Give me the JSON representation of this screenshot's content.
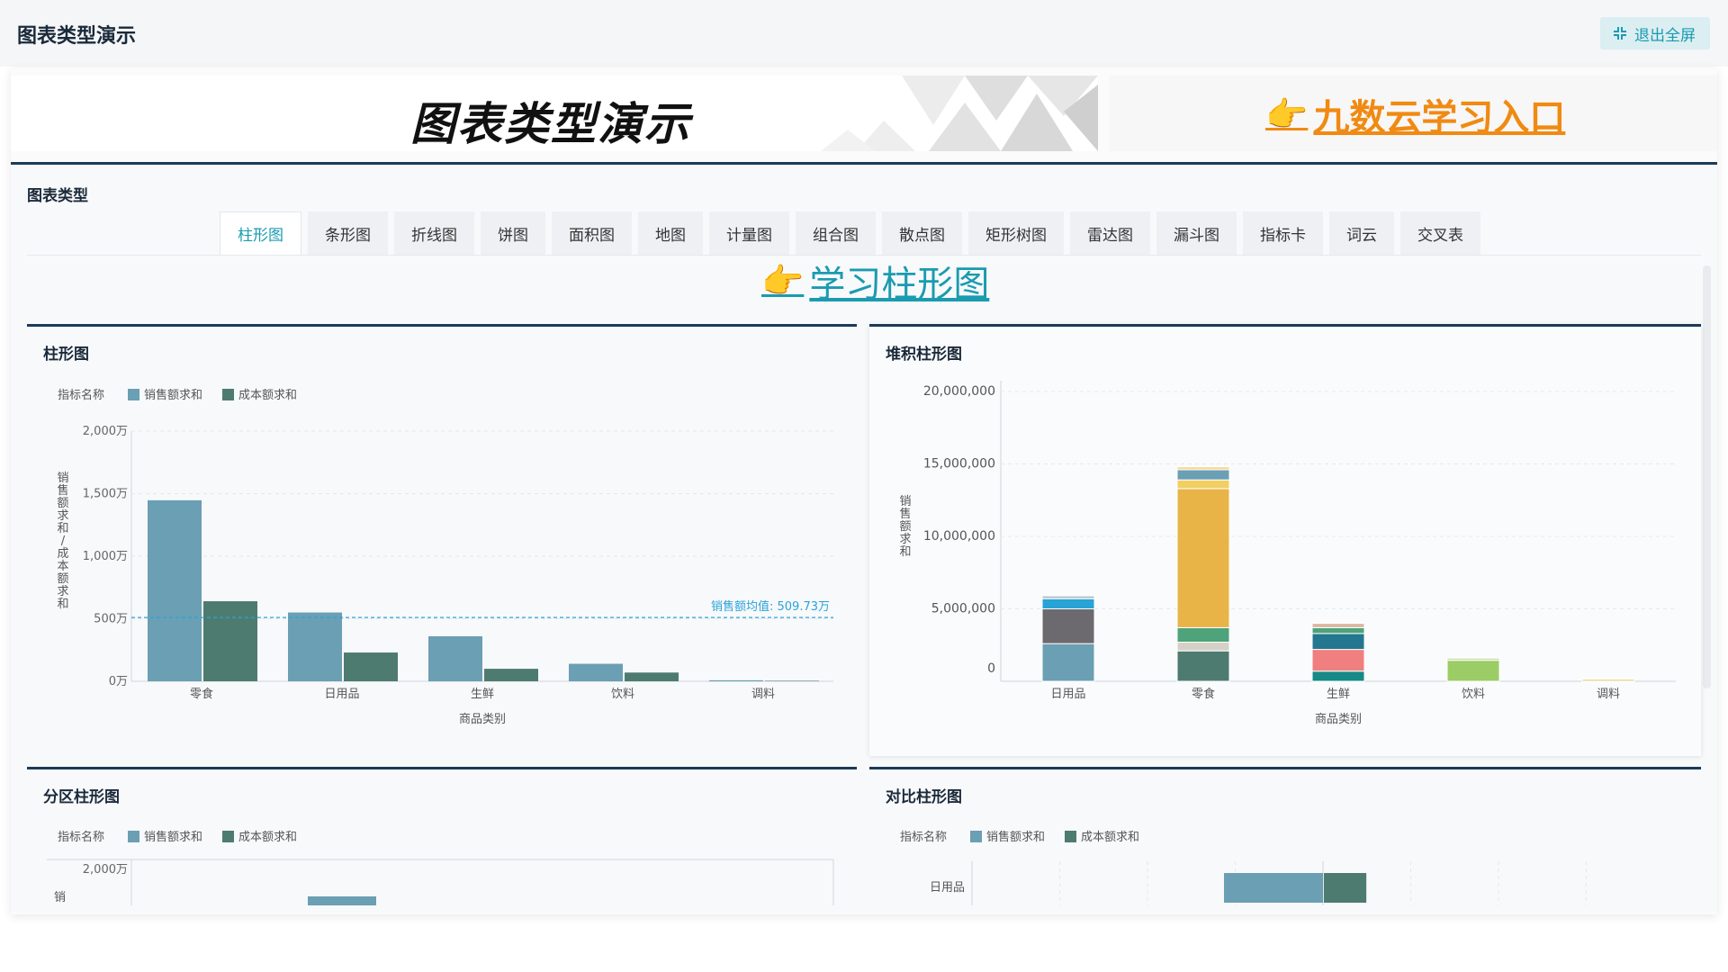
{
  "app": {
    "title": "图表类型演示",
    "exit_fullscreen": "退出全屏"
  },
  "banner": {
    "title": "图表类型演示",
    "entry_link": "九数云学习入口"
  },
  "panel": {
    "title": "图表类型",
    "tabs": [
      {
        "label": "柱形图",
        "active": true
      },
      {
        "label": "条形图"
      },
      {
        "label": "折线图"
      },
      {
        "label": "饼图"
      },
      {
        "label": "面积图"
      },
      {
        "label": "地图"
      },
      {
        "label": "计量图"
      },
      {
        "label": "组合图"
      },
      {
        "label": "散点图"
      },
      {
        "label": "矩形树图"
      },
      {
        "label": "雷达图"
      },
      {
        "label": "漏斗图"
      },
      {
        "label": "指标卡"
      },
      {
        "label": "词云"
      },
      {
        "label": "交叉表"
      }
    ],
    "learn_link": "学习柱形图"
  },
  "colors": {
    "sales": "#6b9fb4",
    "cost": "#4e7b70",
    "accent": "#1a9bb0",
    "brand_orange": "#f08a12",
    "header_navy": "#1d3a57",
    "avg_line": "#2aa3d9"
  },
  "chart_data": [
    {
      "type": "bar",
      "title": "柱形图",
      "legend_title": "指标名称",
      "legend_position": "top-left",
      "categories": [
        "零食",
        "日用品",
        "生鲜",
        "饮料",
        "调料"
      ],
      "series": [
        {
          "name": "销售额求和",
          "values": [
            1447,
            550,
            360,
            140,
            8
          ]
        },
        {
          "name": "成本额求和",
          "values": [
            640,
            230,
            100,
            70,
            4
          ]
        }
      ],
      "y_ticks": [
        "0万",
        "500万",
        "1,000万",
        "1,500万",
        "2,000万"
      ],
      "ylim": [
        0,
        2000
      ],
      "ylabel": "销售额求和/成本额求和",
      "xlabel": "商品类别",
      "reference_line": {
        "label": "销售额均值: 509.73万",
        "value": 509.73
      },
      "grid": true
    },
    {
      "type": "bar",
      "stacked": true,
      "title": "堆积柱形图",
      "categories": [
        "日用品",
        "零食",
        "生鲜",
        "饮料",
        "调料"
      ],
      "stacks": [
        [
          {
            "value": 2600000,
            "color": "#6b9fb4"
          },
          {
            "value": 2400000,
            "color": "#6c6a6e"
          },
          {
            "value": 700000,
            "color": "#27a3d6"
          },
          {
            "value": 200000,
            "color": "#b7c4cc"
          }
        ],
        [
          {
            "value": 2100000,
            "color": "#4e7b70"
          },
          {
            "value": 600000,
            "color": "#d6d0c8"
          },
          {
            "value": 1000000,
            "color": "#4fa37a"
          },
          {
            "value": 9600000,
            "color": "#e9b447"
          },
          {
            "value": 600000,
            "color": "#f1cf63"
          },
          {
            "value": 700000,
            "color": "#6b9fb4"
          },
          {
            "value": 200000,
            "color": "#f4d890"
          }
        ],
        [
          {
            "value": 700000,
            "color": "#168a87"
          },
          {
            "value": 1500000,
            "color": "#f07f7f"
          },
          {
            "value": 1100000,
            "color": "#23778f"
          },
          {
            "value": 400000,
            "color": "#4fa37a"
          },
          {
            "value": 300000,
            "color": "#d9b8a2"
          }
        ],
        [
          {
            "value": 1450000,
            "color": "#9ccc65"
          },
          {
            "value": 150000,
            "color": "#c7dca8"
          }
        ],
        [
          {
            "value": 150000,
            "color": "#e6d690"
          },
          {
            "value": 50000,
            "color": "#b9c26a"
          }
        ]
      ],
      "y_ticks": [
        "0",
        "5,000,000",
        "10,000,000",
        "15,000,000",
        "20,000,000"
      ],
      "ylim": [
        0,
        20000000
      ],
      "ylabel": "销售额求和",
      "xlabel": "商品类别",
      "grid": true
    },
    {
      "type": "bar",
      "title": "分区柱形图",
      "legend_title": "指标名称",
      "legend_position": "top-left",
      "series": [
        {
          "name": "销售额求和"
        },
        {
          "name": "成本额求和"
        }
      ],
      "y_ticks": [
        "2,000万"
      ],
      "ylabel_visible": "销",
      "partial": true
    },
    {
      "type": "bar",
      "orientation": "horizontal",
      "title": "对比柱形图",
      "legend_title": "指标名称",
      "legend_position": "top-left",
      "categories": [
        "日用品"
      ],
      "series": [
        {
          "name": "销售额求和",
          "values": [
            550
          ]
        },
        {
          "name": "成本额求和",
          "values": [
            230
          ]
        }
      ],
      "partial": true
    }
  ]
}
